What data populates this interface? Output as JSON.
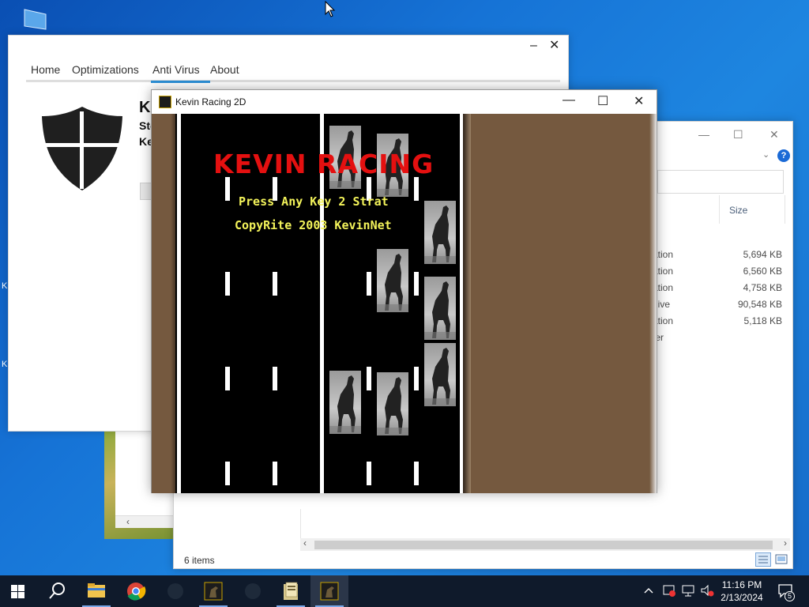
{
  "desktop": {
    "left_letters": [
      "K",
      "K"
    ]
  },
  "antivirus": {
    "tabs": [
      "Home",
      "Optimizations",
      "Anti Virus",
      "About"
    ],
    "active_tab": "Anti Virus",
    "title_partial": "Ke",
    "line1_partial": "Sto",
    "line2_partial": "Ke",
    "minimize_glyph": "–",
    "close_glyph": "✕"
  },
  "explorer": {
    "size_header": "Size",
    "rows": [
      {
        "type": "cation",
        "size": "5,694 KB"
      },
      {
        "type": "cation",
        "size": "6,560 KB"
      },
      {
        "type": "cation",
        "size": "4,758 KB"
      },
      {
        "type": "chive",
        "size": "90,548 KB"
      },
      {
        "type": "cation",
        "size": "5,118 KB"
      },
      {
        "type": "lder",
        "size": ""
      }
    ],
    "status": "6 items",
    "help_glyph": "?",
    "controls": [
      "—",
      "☐",
      "✕"
    ]
  },
  "game": {
    "window_title": "Kevin Racing 2D",
    "heading": "KEVIN RACING",
    "press_text": "Press Any Key 2 Strat",
    "copyright_text": "CopyRite 2003 KevinNet",
    "controls": [
      "—",
      "☐",
      "✕"
    ]
  },
  "taskbar": {
    "items": [
      "start",
      "search",
      "file-explorer",
      "chrome",
      "app-dark",
      "kevin-racing-1",
      "app-dark-2",
      "installer",
      "kevin-racing-active"
    ],
    "time": "11:16 PM",
    "date": "2/13/2024",
    "notification_count": "5",
    "colors": {
      "taskbar": "#0f1a2b",
      "active": "#2b3649"
    }
  }
}
